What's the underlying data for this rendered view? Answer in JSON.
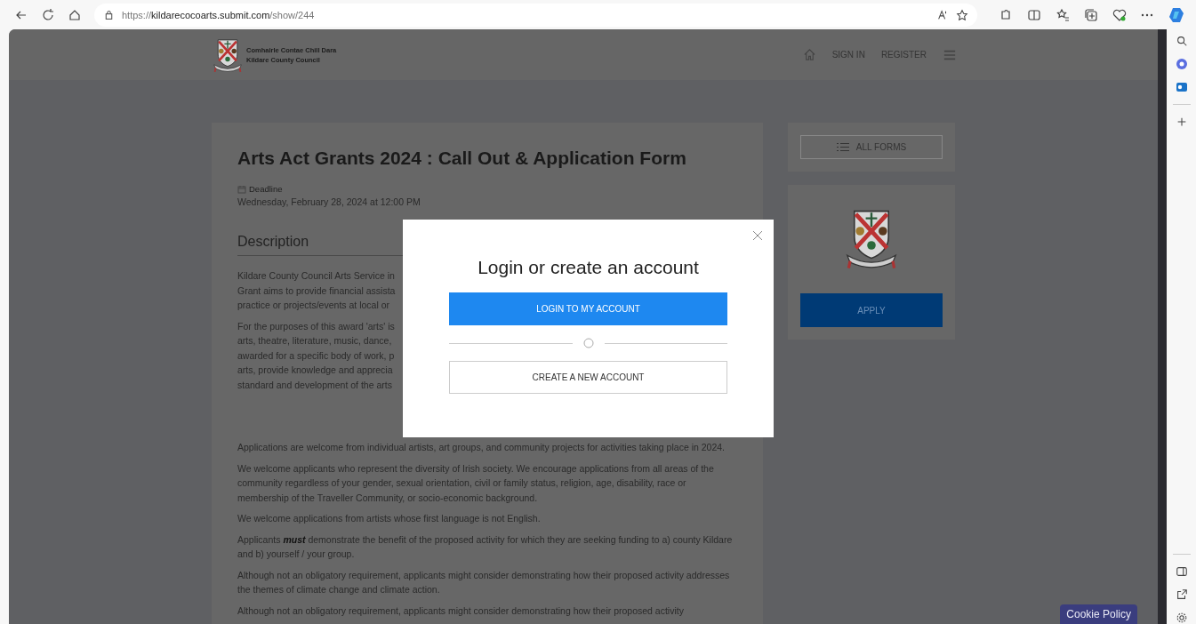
{
  "browser": {
    "url": "https://**kildarecocoarts.submit.com**/show/244"
  },
  "header": {
    "org_name_irish": "Comhairle Contae Chill Dara",
    "org_name_english": "Kildare County Council",
    "nav_links": [
      "SIGN IN",
      "REGISTER"
    ]
  },
  "form": {
    "title": "Arts Act Grants 2024 : Call Out & Application Form",
    "deadline_label": "Deadline",
    "deadline": "Wednesday, February 28, 2024 at 12:00 PM",
    "section_heading": "Description",
    "paragraphs": [
      {
        "kind": "clipped",
        "lines": [
          "Kildare County Council Arts Service in",
          "Grant aims to provide financial assista",
          "practice or projects/events at local or"
        ]
      },
      {
        "kind": "clipped",
        "lines": [
          "For the purposes of this award 'arts' is",
          "arts, theatre, literature, music, dance,",
          "awarded for a specific body of work, p",
          "arts, provide knowledge and apprecia",
          "standard and development of the arts"
        ]
      },
      {
        "kind": "text",
        "text": "Applications are welcome from individual artists, art groups, and community projects for activities taking place in 2024."
      },
      {
        "kind": "text",
        "text": "We welcome applicants who represent the diversity of Irish society. We encourage applications from all areas of the community regardless of your gender, sexual orientation, civil or family status, religion, age, disability, race or membership of the Traveller Community, or socio-economic background."
      },
      {
        "kind": "text",
        "text": "We welcome applications from artists whose first language is not English."
      },
      {
        "kind": "text",
        "text": "Applicants **must** demonstrate the benefit of the proposed activity for which they are seeking funding to a) county Kildare and b) yourself / your group."
      },
      {
        "kind": "text",
        "text": "Although not an obligatory requirement, applicants might consider demonstrating how their proposed activity addresses the themes of climate change and climate action."
      },
      {
        "kind": "text",
        "text": "Although not an obligatory requirement, applicants might consider demonstrating how their proposed activity"
      }
    ]
  },
  "sidebar": {
    "all_forms_button": "ALL FORMS",
    "apply_button": "APPLY"
  },
  "modal": {
    "title": "Login or create an account",
    "primary_button": "LOGIN TO MY ACCOUNT",
    "secondary_button": "CREATE A NEW ACCOUNT"
  },
  "cookie_button": "Cookie Policy"
}
